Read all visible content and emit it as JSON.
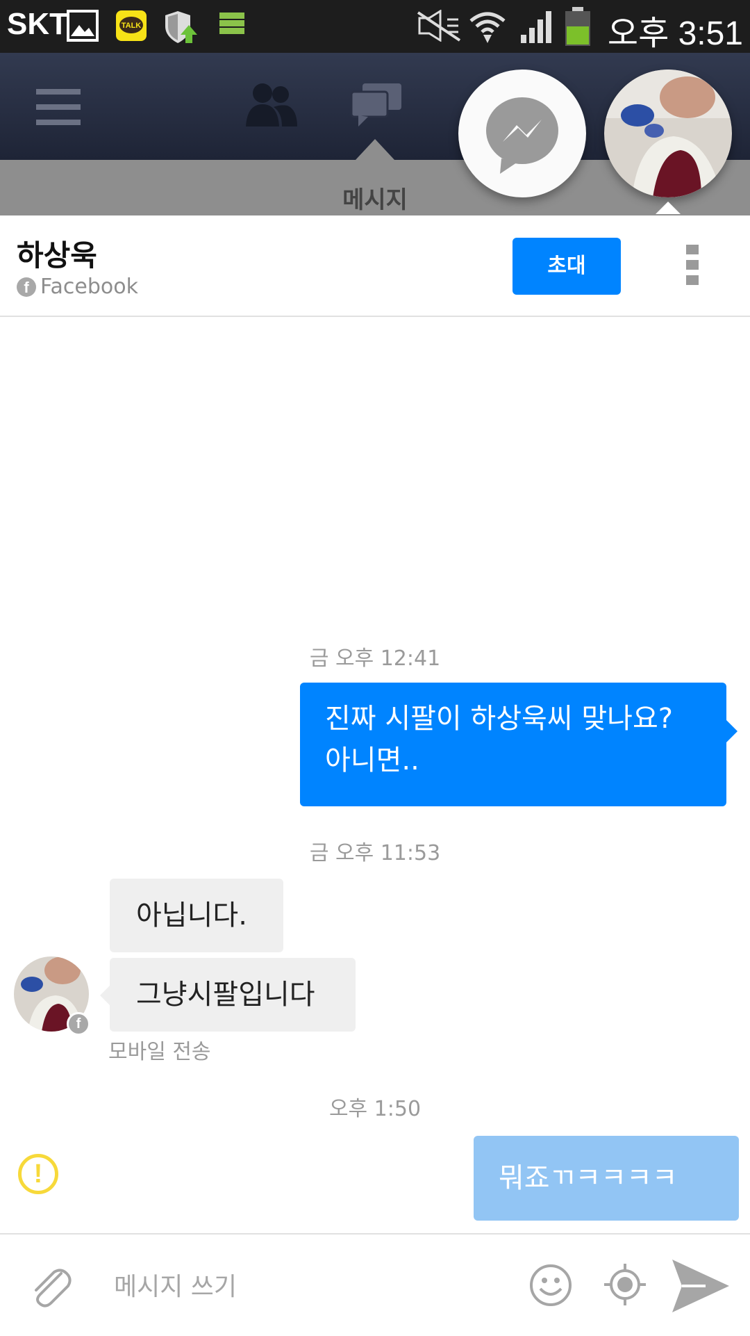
{
  "status_bar": {
    "carrier": "SKT",
    "time": "오후 3:51",
    "icons": [
      "image-icon",
      "kakaotalk-icon",
      "shield-update-icon",
      "storage-icon",
      "mute-icon",
      "wifi-icon",
      "signal-icon",
      "battery-icon"
    ],
    "kakao_label": "TALK"
  },
  "facebook_nav": {
    "icons": [
      "menu-icon",
      "friends-icon",
      "messages-icon"
    ],
    "active_tab_label": "메시지"
  },
  "chat_heads": [
    "messenger-icon",
    "contact-avatar"
  ],
  "conversation": {
    "contact_name": "하상욱",
    "source": "Facebook",
    "invite_label": "초대",
    "messages": [
      {
        "timestamp": "금 오후 12:41"
      },
      {
        "text_line1": "진짜 시팔이 하상욱씨 맞나요?",
        "text_line2": "아니면.."
      },
      {
        "timestamp": "금 오후 11:53"
      },
      {
        "text": "아닙니다."
      },
      {
        "text": "그냥시팔입니다"
      },
      {
        "note": "모바일 전송"
      },
      {
        "timestamp": "오후 1:50"
      },
      {
        "text": "뭐죠ㄲㅋㅋㅋㅋ"
      }
    ],
    "error_symbol": "!"
  },
  "composer": {
    "placeholder": "메시지 쓰기",
    "icons": [
      "attach-icon",
      "emoji-icon",
      "location-icon",
      "send-icon"
    ]
  },
  "colors": {
    "accent": "#0084ff",
    "pending_bubble": "#92c5f4",
    "incoming_bubble": "#efefef",
    "nav_bg": "#2a3044",
    "error": "#f7d93a"
  }
}
